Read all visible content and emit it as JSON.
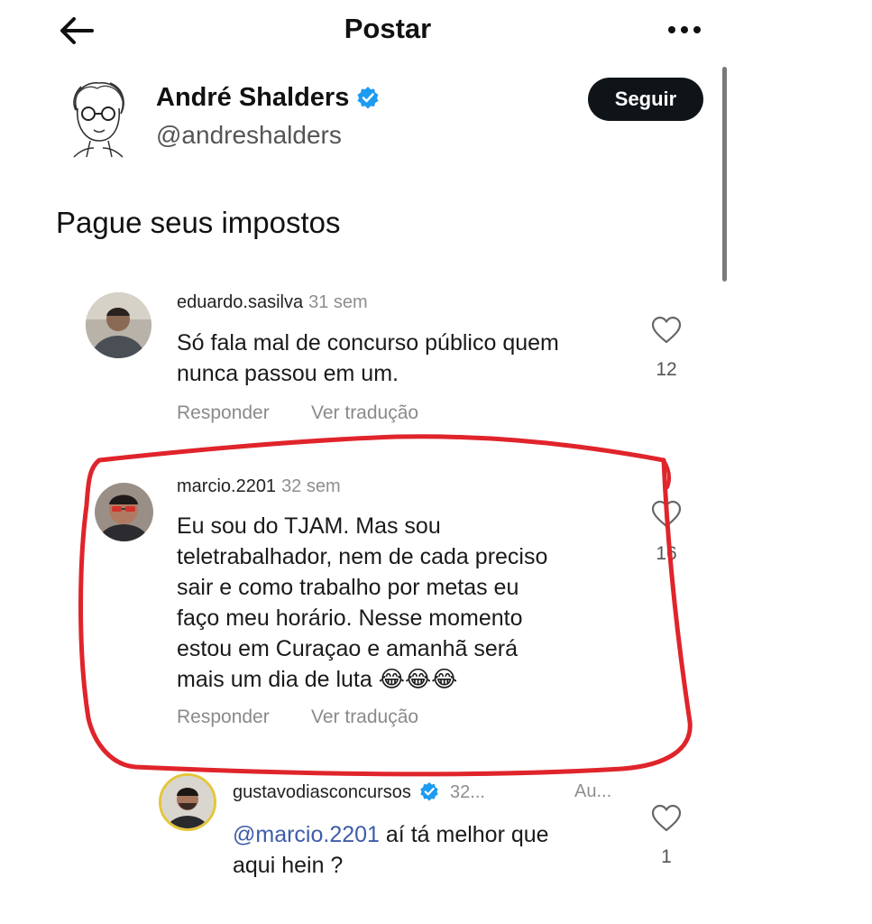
{
  "header": {
    "title": "Postar"
  },
  "post": {
    "author_name": "André Shalders",
    "author_handle": "@andreshalders",
    "follow_label": "Seguir",
    "text": "Pague seus impostos"
  },
  "comments": [
    {
      "username": "eduardo.sasilva",
      "time": "31 sem",
      "lines": [
        "Só fala mal de concurso público quem",
        "nunca passou em um."
      ],
      "likes": "12",
      "reply_label": "Responder",
      "translate_label": "Ver tradução"
    },
    {
      "username": "marcio.2201",
      "time": "32 sem",
      "lines": [
        "Eu sou do TJAM. Mas sou",
        "teletrabalhador, nem de cada preciso",
        "sair e como trabalho por metas eu",
        "faço meu horário. Nesse momento",
        "estou em Curaçao e amanhã será",
        "mais um dia de luta"
      ],
      "emoji": "😂😂😂",
      "likes": "16",
      "reply_label": "Responder",
      "translate_label": "Ver tradução"
    },
    {
      "username": "gustavodiasconcursos",
      "time": "32...",
      "author_tag": "Au...",
      "mention": "@marcio.2201",
      "lines": [
        " aí tá melhor que",
        "aqui hein ?"
      ],
      "likes": "1"
    }
  ],
  "colors": {
    "accent_blue": "#1d9bf0",
    "highlight_red": "#e0242b",
    "follow_bg": "#0f1419"
  }
}
